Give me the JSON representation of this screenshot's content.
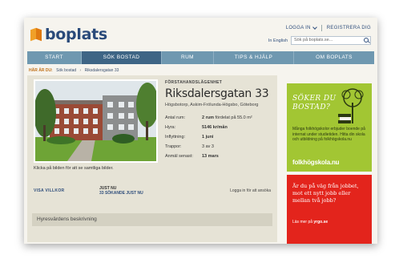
{
  "header": {
    "logo_text": "boplats",
    "login": "LOGGA IN",
    "register": "REGISTRERA DIG",
    "lang": "In English",
    "search_placeholder": "Sök på boplats.se..."
  },
  "nav": [
    {
      "label": "START",
      "active": false
    },
    {
      "label": "SÖK BOSTAD",
      "active": true
    },
    {
      "label": "RUM",
      "active": false
    },
    {
      "label": "TIPS & HJÄLP",
      "active": false
    },
    {
      "label": "OM BOPLATS",
      "active": false
    }
  ],
  "breadcrumb": {
    "prefix": "HÄR ÄR DU:",
    "items": [
      "Sök bostad",
      "Riksdalersgatan 33"
    ]
  },
  "listing": {
    "type": "FÖRSTAHANDSLÄGENHET",
    "title": "Riksdalersgatan 33",
    "location": "Högsbotorp, Askim-Frölunda-Högsbo, Göteborg",
    "photo_caption": "Klicka på bilden för att se samtliga bilder.",
    "facts": [
      {
        "key": "Antal rum:",
        "bold": "2 rum",
        "rest": " fördelat på 55.0 m²"
      },
      {
        "key": "Hyra:",
        "bold": "5146 kr/mån",
        "rest": ""
      },
      {
        "key": "Inflyttning:",
        "bold": "1 juni",
        "rest": ""
      },
      {
        "key": "Trappor:",
        "bold": "",
        "rest": "3 av 3"
      },
      {
        "key": "Anmäl senast:",
        "bold": "13 mars",
        "rest": ""
      }
    ],
    "visa_villkor": "VISA VILLKOR",
    "just_nu": "JUST NU",
    "sokande": "33 SÖKANDE JUST NU",
    "logga_in_ansok": "Logga in för att ansöka",
    "description_bar": "Hyresvärdens beskrivning"
  },
  "ad_green": {
    "headline_1": "SÖKER DU",
    "headline_2": "BOSTAD?",
    "body": "Många folkhögskolor erbjuder boende på internat under studietiden. Hitta din skola och utbildning på folkhögskola.nu",
    "brand": "folkhögskola.nu",
    "color": "#a2c633"
  },
  "ad_red": {
    "headline": "Är du på väg från jobbet, mot ett nytt jobb eller mellan två jobb?",
    "more_prefix": "Läs mer på ",
    "more_link": "yrgo.se",
    "color": "#e3241c"
  }
}
